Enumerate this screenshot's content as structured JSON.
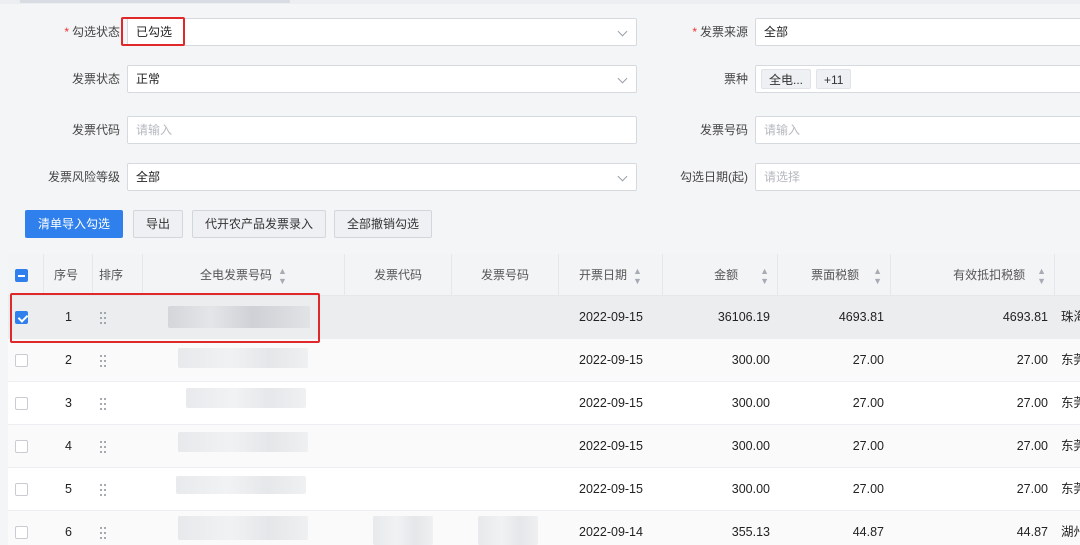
{
  "form": {
    "check_status": {
      "label": "勾选状态",
      "required": true,
      "value": "已勾选"
    },
    "invoice_source": {
      "label": "发票来源",
      "required": true,
      "value": "全部"
    },
    "invoice_status": {
      "label": "发票状态",
      "value": "正常"
    },
    "invoice_type": {
      "label": "票种",
      "tag1": "全电...",
      "tag2": "+11"
    },
    "invoice_code": {
      "label": "发票代码",
      "placeholder": "请输入"
    },
    "invoice_number": {
      "label": "发票号码",
      "placeholder": "请输入"
    },
    "risk_level": {
      "label": "发票风险等级",
      "value": "全部"
    },
    "check_date": {
      "label": "勾选日期(起)",
      "placeholder": "请选择"
    }
  },
  "toolbar": {
    "import_check": "清单导入勾选",
    "export": "导出",
    "agri_entry": "代开农产品发票录入",
    "cancel_all": "全部撤销勾选"
  },
  "table": {
    "headers": {
      "seq": "序号",
      "sort": "排序",
      "full_elec_no": "全电发票号码",
      "code": "发票代码",
      "number": "发票号码",
      "date": "开票日期",
      "amount": "金额",
      "tax": "票面税额",
      "valid_tax": "有效抵扣税额"
    },
    "rows": [
      {
        "seq": "1",
        "date": "2022-09-15",
        "amount": "36106.19",
        "tax": "4693.81",
        "valid_tax": "4693.81",
        "extra": "珠海",
        "checked": true
      },
      {
        "seq": "2",
        "date": "2022-09-15",
        "amount": "300.00",
        "tax": "27.00",
        "valid_tax": "27.00",
        "extra": "东莞",
        "checked": false
      },
      {
        "seq": "3",
        "date": "2022-09-15",
        "amount": "300.00",
        "tax": "27.00",
        "valid_tax": "27.00",
        "extra": "东莞",
        "checked": false
      },
      {
        "seq": "4",
        "date": "2022-09-15",
        "amount": "300.00",
        "tax": "27.00",
        "valid_tax": "27.00",
        "extra": "东莞",
        "checked": false
      },
      {
        "seq": "5",
        "date": "2022-09-15",
        "amount": "300.00",
        "tax": "27.00",
        "valid_tax": "27.00",
        "extra": "东莞",
        "checked": false
      },
      {
        "seq": "6",
        "date": "2022-09-14",
        "amount": "355.13",
        "tax": "44.87",
        "valid_tax": "44.87",
        "extra": "湖州",
        "checked": false
      }
    ]
  },
  "colors": {
    "primary": "#2f80ed",
    "highlight": "#e0282b",
    "required": "#e33333"
  },
  "icons": {
    "dropdown": "chevron-down-icon",
    "drag": "drag-handle-icon",
    "sort": "sort-icon",
    "checkbox": "checkbox-icon"
  }
}
